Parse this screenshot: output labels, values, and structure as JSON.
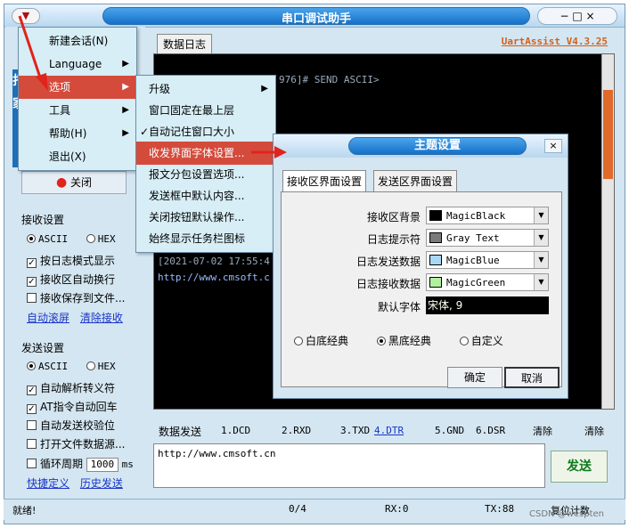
{
  "window": {
    "title": "串口调试助手",
    "sys_controls": "− □ ×",
    "app_icon": "▼"
  },
  "main_menu": {
    "items": [
      {
        "label": "新建会话(N)",
        "arrow": ""
      },
      {
        "label": "Language",
        "arrow": "▶"
      },
      {
        "label": "选项",
        "arrow": "▶"
      },
      {
        "label": "工具",
        "arrow": "▶"
      },
      {
        "label": "帮助(H)",
        "arrow": "▶"
      },
      {
        "label": "退出(X)",
        "arrow": ""
      }
    ]
  },
  "options_menu": {
    "items": [
      {
        "label": "升级",
        "arrow": "▶"
      },
      {
        "label": "窗口固定在最上层",
        "arrow": ""
      },
      {
        "label": "✓自动记住窗口大小",
        "arrow": ""
      },
      {
        "label": "收发界面字体设置...",
        "arrow": ""
      },
      {
        "label": "报文分包设置选项...",
        "arrow": ""
      },
      {
        "label": "发送框中默认内容...",
        "arrow": ""
      },
      {
        "label": "关闭按钮默认操作...",
        "arrow": ""
      },
      {
        "label": "始终显示任务栏图标",
        "arrow": ""
      }
    ]
  },
  "left": {
    "vertical_text": "打人家团",
    "close_label": "关闭",
    "recv": {
      "title": "接收设置",
      "ascii": "ASCII",
      "hex": "HEX",
      "opt1": "按日志模式显示",
      "opt2": "接收区自动换行",
      "opt3": "接收保存到文件...",
      "link1": "自动滚屏",
      "link2": "清除接收"
    },
    "send": {
      "title": "发送设置",
      "ascii": "ASCII",
      "hex": "HEX",
      "opt1": "自动解析转义符",
      "opt2": "AT指令自动回车",
      "opt3": "自动发送校验位",
      "opt4": "打开文件数据源...",
      "opt5": "循环周期",
      "period": "1000",
      "unit": "ms",
      "link1": "快捷定义",
      "link2": "历史发送"
    }
  },
  "log": {
    "tab": "数据日志",
    "version": "UartAssist V4.3.25",
    "line1": "976]# SEND ASCII>",
    "line2": "[2021-07-02 17:55:4",
    "line3": "http://www.cmsoft.c"
  },
  "sendbar": {
    "tab": "数据发送",
    "signals": [
      "1.DCD",
      "2.RXD",
      "3.TXD",
      "4.DTR",
      "5.GND",
      "6.DSR"
    ],
    "clear1": "清除",
    "clear2": "清除",
    "content": "http://www.cmsoft.cn",
    "send_button": "发送"
  },
  "status": {
    "ready": "就绪!",
    "counter": "0/4",
    "rx": "RX:0",
    "tx": "TX:88",
    "reset": "复位计数",
    "watermark": "CSDN @wespten"
  },
  "dialog": {
    "title": "主题设置",
    "close": "×",
    "tab1": "接收区界面设置",
    "tab2": "发送区界面设置",
    "rows": [
      {
        "label": "接收区背景",
        "value": "MagicBlack",
        "color": "#000000"
      },
      {
        "label": "日志提示符",
        "value": "Gray Text",
        "color": "#7a7a7a"
      },
      {
        "label": "日志发送数据",
        "value": "MagicBlue",
        "color": "#a9d8f2"
      },
      {
        "label": "日志接收数据",
        "value": "MagicGreen",
        "color": "#b2f0a0"
      }
    ],
    "font_label": "默认字体",
    "font_value": "宋体, 9",
    "themes": [
      "白底经典",
      "黑底经典",
      "自定义"
    ],
    "ok": "确定",
    "cancel": "取消"
  }
}
